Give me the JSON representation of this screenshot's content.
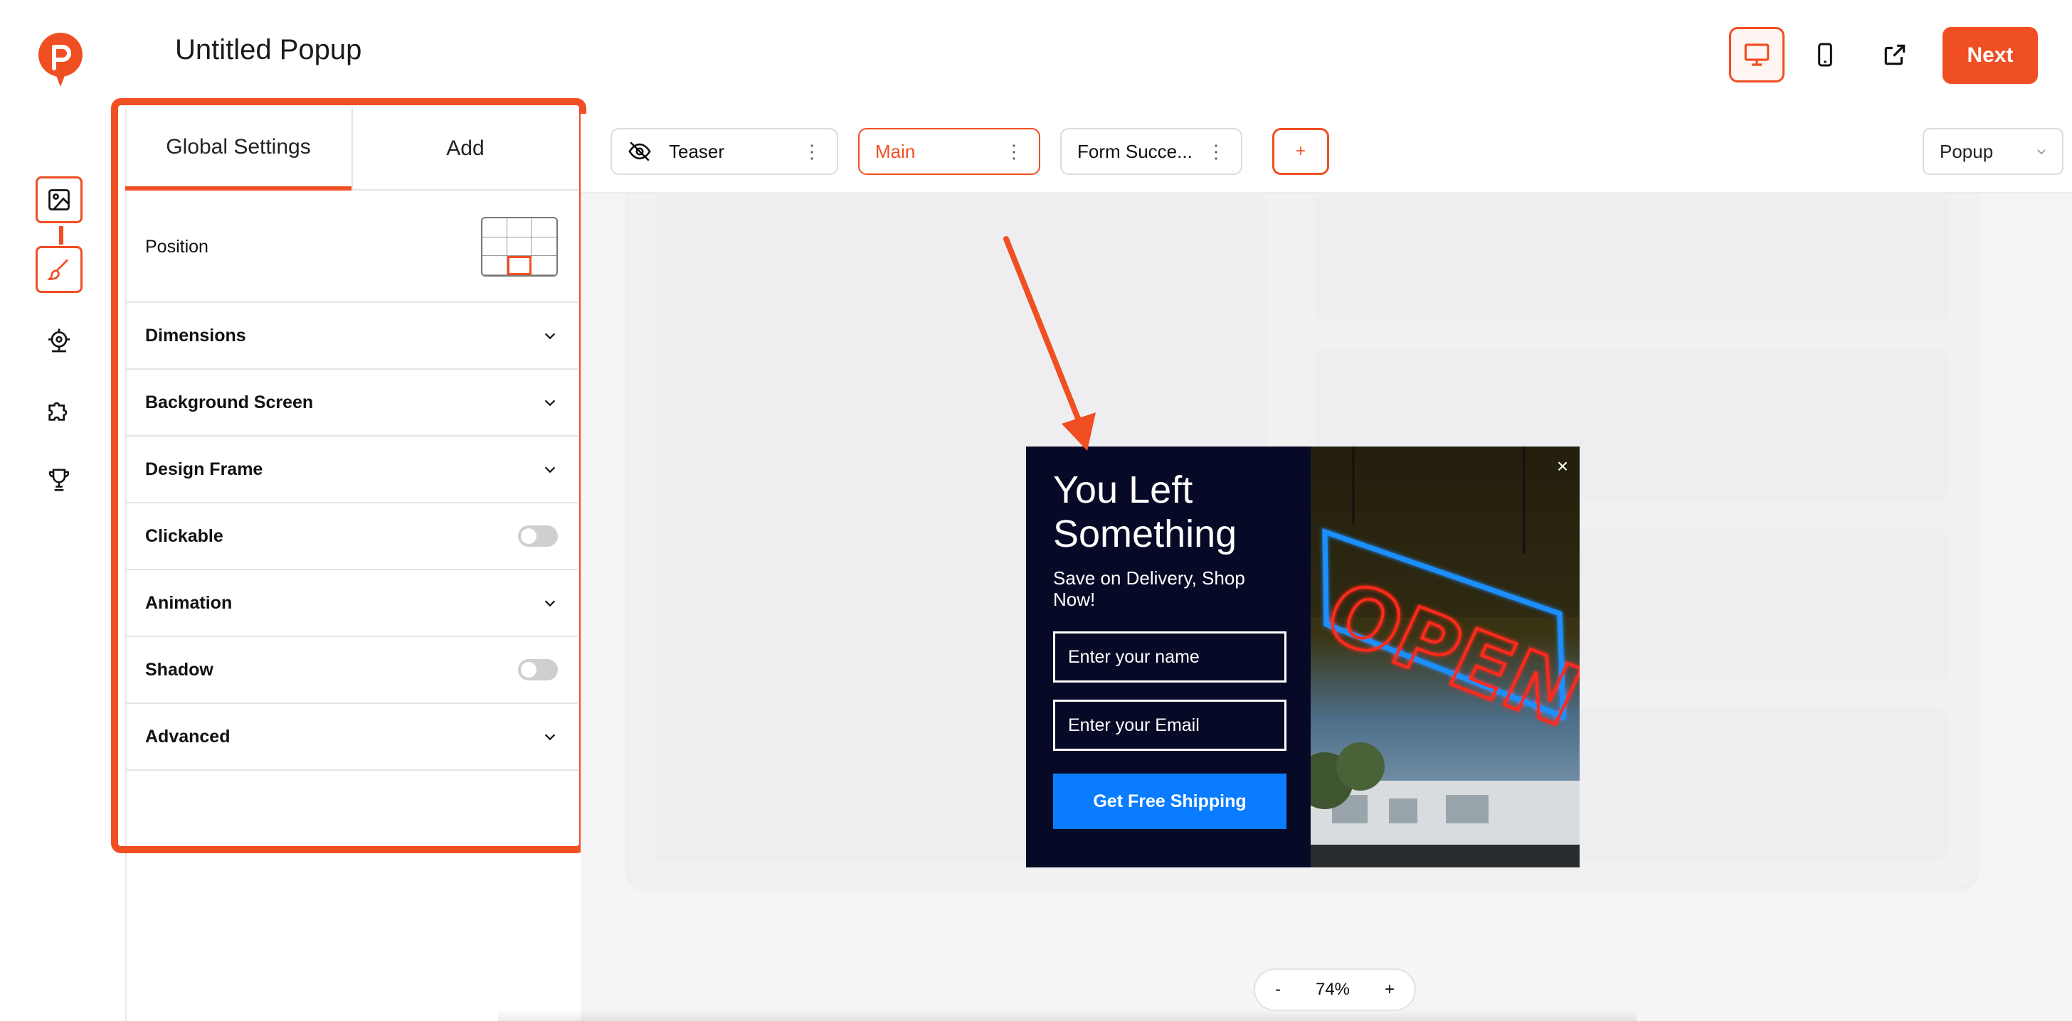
{
  "app": {
    "title": "Untitled Popup",
    "next_label": "Next",
    "accent_color": "#f04e23"
  },
  "rail": {
    "items": [
      {
        "icon": "image-icon",
        "active": true
      },
      {
        "icon": "brush-icon",
        "active": true
      },
      {
        "icon": "target-icon",
        "active": false
      },
      {
        "icon": "puzzle-icon",
        "active": false
      },
      {
        "icon": "trophy-icon",
        "active": false
      }
    ]
  },
  "header_icons": [
    "desktop-icon",
    "mobile-icon",
    "external-link-icon"
  ],
  "panel": {
    "tabs": [
      {
        "label": "Global Settings",
        "active": true
      },
      {
        "label": "Add",
        "active": false
      }
    ],
    "position_label": "Position",
    "rows": [
      {
        "label": "Dimensions",
        "control": "chevron"
      },
      {
        "label": "Background Screen",
        "control": "chevron"
      },
      {
        "label": "Design Frame",
        "control": "chevron"
      },
      {
        "label": "Clickable",
        "control": "toggle",
        "on": false
      },
      {
        "label": "Animation",
        "control": "chevron"
      },
      {
        "label": "Shadow",
        "control": "toggle",
        "on": false
      },
      {
        "label": "Advanced",
        "control": "chevron"
      }
    ]
  },
  "steps": [
    {
      "label": "Teaser",
      "icon": "eye-off-icon",
      "active": false
    },
    {
      "label": "Main",
      "active": true
    },
    {
      "label": "Form Succe...",
      "active": false
    }
  ],
  "add_step_label": "+",
  "type_select": "Popup",
  "popup": {
    "title": "You Left Something",
    "subtitle": "Save on Delivery, Shop Now!",
    "name_placeholder": "Enter your name",
    "email_placeholder": "Enter your Email",
    "button_label": "Get Free Shipping",
    "close_label": "×",
    "bg_color": "#060a26",
    "button_color": "#0a7cff",
    "image": "neon OPEN sign"
  },
  "zoom": {
    "minus": "-",
    "value": "74%",
    "plus": "+"
  }
}
